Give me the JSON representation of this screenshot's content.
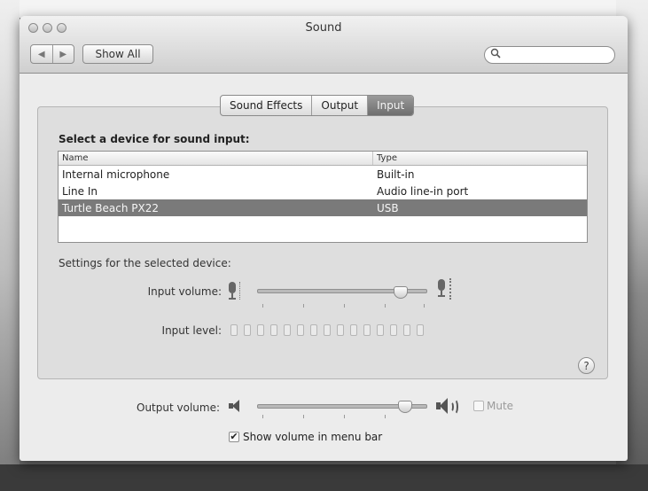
{
  "window": {
    "title": "Sound",
    "back_glyph": "◀",
    "forward_glyph": "▶",
    "show_all_label": "Show All",
    "search_placeholder": "",
    "search_icon": "magnifier-icon"
  },
  "tabs": [
    {
      "label": "Sound Effects",
      "active": false
    },
    {
      "label": "Output",
      "active": false
    },
    {
      "label": "Input",
      "active": true
    }
  ],
  "input": {
    "heading": "Select a device for sound input:",
    "columns": [
      "Name",
      "Type"
    ],
    "devices": [
      {
        "name": "Internal microphone",
        "type": "Built-in",
        "selected": false
      },
      {
        "name": "Line In",
        "type": "Audio line-in port",
        "selected": false
      },
      {
        "name": "Turtle Beach PX22",
        "type": "USB",
        "selected": true
      }
    ],
    "settings_label": "Settings for the selected device:",
    "input_volume_label": "Input volume:",
    "input_volume_level": 0.85,
    "input_level_label": "Input level:",
    "input_level_segments": 15,
    "input_level_lit": 0
  },
  "help_label": "?",
  "output": {
    "volume_label": "Output volume:",
    "volume_level": 0.88,
    "mute_label": "Mute",
    "mute_checked": false,
    "show_in_menu_bar_label": "Show volume in menu bar",
    "show_in_menu_bar_checked": true
  },
  "colors": {
    "selected_row": "#7a7a7a",
    "active_tab": "#7e7e7e",
    "window_bg": "#ececec"
  }
}
